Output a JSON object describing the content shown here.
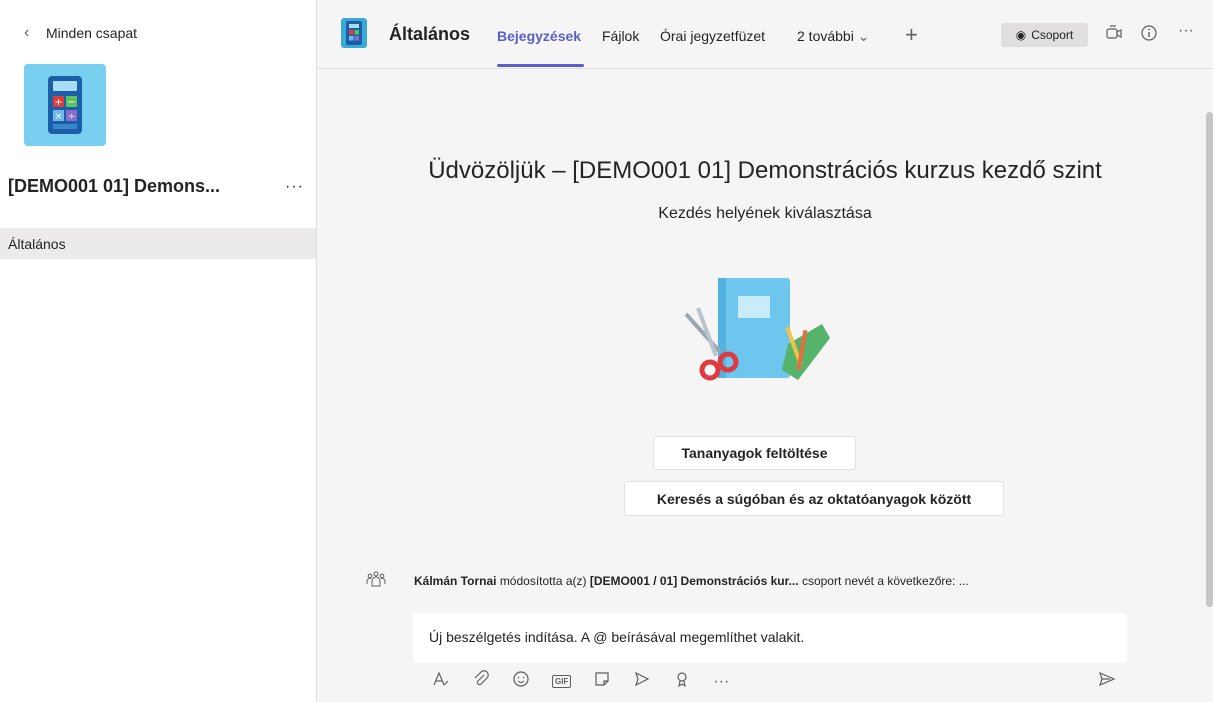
{
  "sidebar": {
    "back_label": "Minden csapat",
    "team_name": "[DEMO001 01] Demons...",
    "team_more": "···",
    "channels": [
      {
        "label": "Általános"
      }
    ]
  },
  "header": {
    "channel_title": "Általános",
    "tabs": [
      {
        "label": "Bejegyzések"
      },
      {
        "label": "Fájlok"
      },
      {
        "label": "Órai jegyzetfüzet"
      },
      {
        "label": "2 további"
      }
    ],
    "group_button": "Csoport",
    "more": "···"
  },
  "main": {
    "welcome": "Üdvözöljük – [DEMO001 01] Demonstrációs kurzus kezdő szint",
    "subtitle": "Kezdés helyének kiválasztása",
    "upload_button": "Tananyagok feltöltése",
    "help_button": "Keresés a súgóban és az oktatóanyagok között"
  },
  "activity": {
    "author": "Kálmán Tornai",
    "verb": "módosította a(z)",
    "team": "[DEMO001 / 01] Demonstrációs kur...",
    "rest": "csoport nevét a következőre: ..."
  },
  "compose": {
    "placeholder": "Új beszélgetés indítása. A @ beírásával megemlíthet valakit.",
    "gif_label": "GIF",
    "more": "···"
  },
  "colors": {
    "accent": "#5b5fc7",
    "team_tile": "#79cff0",
    "sidebar_selected": "#edebe9"
  }
}
